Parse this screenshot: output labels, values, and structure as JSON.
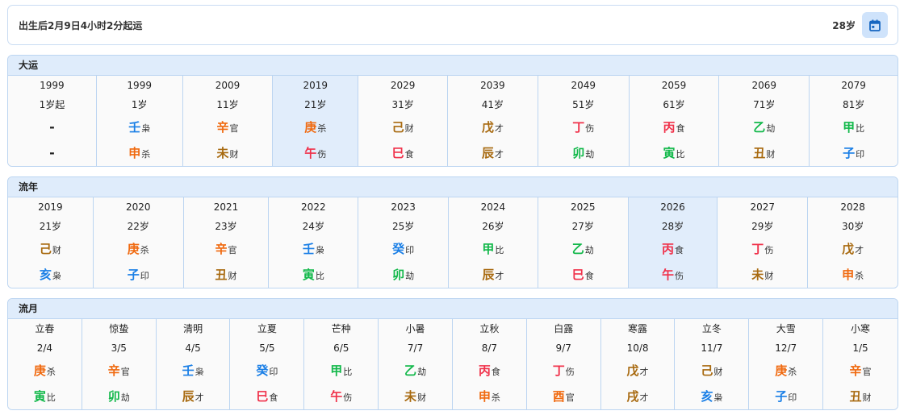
{
  "header": {
    "qiyun_text": "出生后2月9日4小时2分起运",
    "age": "28岁",
    "calendar_icon": "calendar-icon"
  },
  "dayun": {
    "title": "大运",
    "columns": [
      {
        "l1": "1999",
        "l2": "1岁起",
        "gan": "-",
        "gan_ss": "",
        "gan_el": "",
        "zhi": "-",
        "zhi_ss": "",
        "zhi_el": "",
        "cur": false
      },
      {
        "l1": "1999",
        "l2": "1岁",
        "gan": "壬",
        "gan_ss": "枭",
        "gan_el": "water",
        "zhi": "申",
        "zhi_ss": "杀",
        "zhi_el": "metal",
        "cur": false
      },
      {
        "l1": "2009",
        "l2": "11岁",
        "gan": "辛",
        "gan_ss": "官",
        "gan_el": "metal",
        "zhi": "未",
        "zhi_ss": "财",
        "zhi_el": "earth",
        "cur": false
      },
      {
        "l1": "2019",
        "l2": "21岁",
        "gan": "庚",
        "gan_ss": "杀",
        "gan_el": "metal",
        "zhi": "午",
        "zhi_ss": "伤",
        "zhi_el": "fire",
        "cur": true
      },
      {
        "l1": "2029",
        "l2": "31岁",
        "gan": "己",
        "gan_ss": "财",
        "gan_el": "earth",
        "zhi": "巳",
        "zhi_ss": "食",
        "zhi_el": "fire",
        "cur": false
      },
      {
        "l1": "2039",
        "l2": "41岁",
        "gan": "戊",
        "gan_ss": "才",
        "gan_el": "earth",
        "zhi": "辰",
        "zhi_ss": "才",
        "zhi_el": "earth",
        "cur": false
      },
      {
        "l1": "2049",
        "l2": "51岁",
        "gan": "丁",
        "gan_ss": "伤",
        "gan_el": "fire",
        "zhi": "卯",
        "zhi_ss": "劫",
        "zhi_el": "wood",
        "cur": false
      },
      {
        "l1": "2059",
        "l2": "61岁",
        "gan": "丙",
        "gan_ss": "食",
        "gan_el": "fire",
        "zhi": "寅",
        "zhi_ss": "比",
        "zhi_el": "wood",
        "cur": false
      },
      {
        "l1": "2069",
        "l2": "71岁",
        "gan": "乙",
        "gan_ss": "劫",
        "gan_el": "wood",
        "zhi": "丑",
        "zhi_ss": "财",
        "zhi_el": "earth",
        "cur": false
      },
      {
        "l1": "2079",
        "l2": "81岁",
        "gan": "甲",
        "gan_ss": "比",
        "gan_el": "wood",
        "zhi": "子",
        "zhi_ss": "印",
        "zhi_el": "water",
        "cur": false
      }
    ]
  },
  "liunian": {
    "title": "流年",
    "columns": [
      {
        "l1": "2019",
        "l2": "21岁",
        "gan": "己",
        "gan_ss": "财",
        "gan_el": "earth",
        "zhi": "亥",
        "zhi_ss": "枭",
        "zhi_el": "water",
        "cur": false
      },
      {
        "l1": "2020",
        "l2": "22岁",
        "gan": "庚",
        "gan_ss": "杀",
        "gan_el": "metal",
        "zhi": "子",
        "zhi_ss": "印",
        "zhi_el": "water",
        "cur": false
      },
      {
        "l1": "2021",
        "l2": "23岁",
        "gan": "辛",
        "gan_ss": "官",
        "gan_el": "metal",
        "zhi": "丑",
        "zhi_ss": "财",
        "zhi_el": "earth",
        "cur": false
      },
      {
        "l1": "2022",
        "l2": "24岁",
        "gan": "壬",
        "gan_ss": "枭",
        "gan_el": "water",
        "zhi": "寅",
        "zhi_ss": "比",
        "zhi_el": "wood",
        "cur": false
      },
      {
        "l1": "2023",
        "l2": "25岁",
        "gan": "癸",
        "gan_ss": "印",
        "gan_el": "water",
        "zhi": "卯",
        "zhi_ss": "劫",
        "zhi_el": "wood",
        "cur": false
      },
      {
        "l1": "2024",
        "l2": "26岁",
        "gan": "甲",
        "gan_ss": "比",
        "gan_el": "wood",
        "zhi": "辰",
        "zhi_ss": "才",
        "zhi_el": "earth",
        "cur": false
      },
      {
        "l1": "2025",
        "l2": "27岁",
        "gan": "乙",
        "gan_ss": "劫",
        "gan_el": "wood",
        "zhi": "巳",
        "zhi_ss": "食",
        "zhi_el": "fire",
        "cur": false
      },
      {
        "l1": "2026",
        "l2": "28岁",
        "gan": "丙",
        "gan_ss": "食",
        "gan_el": "fire",
        "zhi": "午",
        "zhi_ss": "伤",
        "zhi_el": "fire",
        "cur": true
      },
      {
        "l1": "2027",
        "l2": "29岁",
        "gan": "丁",
        "gan_ss": "伤",
        "gan_el": "fire",
        "zhi": "未",
        "zhi_ss": "财",
        "zhi_el": "earth",
        "cur": false
      },
      {
        "l1": "2028",
        "l2": "30岁",
        "gan": "戊",
        "gan_ss": "才",
        "gan_el": "earth",
        "zhi": "申",
        "zhi_ss": "杀",
        "zhi_el": "metal",
        "cur": false
      }
    ]
  },
  "liuyue": {
    "title": "流月",
    "columns": [
      {
        "l1": "立春",
        "l2": "2/4",
        "gan": "庚",
        "gan_ss": "杀",
        "gan_el": "metal",
        "zhi": "寅",
        "zhi_ss": "比",
        "zhi_el": "wood",
        "cur": false
      },
      {
        "l1": "惊蛰",
        "l2": "3/5",
        "gan": "辛",
        "gan_ss": "官",
        "gan_el": "metal",
        "zhi": "卯",
        "zhi_ss": "劫",
        "zhi_el": "wood",
        "cur": false
      },
      {
        "l1": "清明",
        "l2": "4/5",
        "gan": "壬",
        "gan_ss": "枭",
        "gan_el": "water",
        "zhi": "辰",
        "zhi_ss": "才",
        "zhi_el": "earth",
        "cur": false
      },
      {
        "l1": "立夏",
        "l2": "5/5",
        "gan": "癸",
        "gan_ss": "印",
        "gan_el": "water",
        "zhi": "巳",
        "zhi_ss": "食",
        "zhi_el": "fire",
        "cur": false
      },
      {
        "l1": "芒种",
        "l2": "6/5",
        "gan": "甲",
        "gan_ss": "比",
        "gan_el": "wood",
        "zhi": "午",
        "zhi_ss": "伤",
        "zhi_el": "fire",
        "cur": false
      },
      {
        "l1": "小暑",
        "l2": "7/7",
        "gan": "乙",
        "gan_ss": "劫",
        "gan_el": "wood",
        "zhi": "未",
        "zhi_ss": "财",
        "zhi_el": "earth",
        "cur": false
      },
      {
        "l1": "立秋",
        "l2": "8/7",
        "gan": "丙",
        "gan_ss": "食",
        "gan_el": "fire",
        "zhi": "申",
        "zhi_ss": "杀",
        "zhi_el": "metal",
        "cur": false
      },
      {
        "l1": "白露",
        "l2": "9/7",
        "gan": "丁",
        "gan_ss": "伤",
        "gan_el": "fire",
        "zhi": "酉",
        "zhi_ss": "官",
        "zhi_el": "metal",
        "cur": false
      },
      {
        "l1": "寒露",
        "l2": "10/8",
        "gan": "戊",
        "gan_ss": "才",
        "gan_el": "earth",
        "zhi": "戌",
        "zhi_ss": "才",
        "zhi_el": "earth",
        "cur": false
      },
      {
        "l1": "立冬",
        "l2": "11/7",
        "gan": "己",
        "gan_ss": "财",
        "gan_el": "earth",
        "zhi": "亥",
        "zhi_ss": "枭",
        "zhi_el": "water",
        "cur": false
      },
      {
        "l1": "大雪",
        "l2": "12/7",
        "gan": "庚",
        "gan_ss": "杀",
        "gan_el": "metal",
        "zhi": "子",
        "zhi_ss": "印",
        "zhi_el": "water",
        "cur": false
      },
      {
        "l1": "小寒",
        "l2": "1/5",
        "gan": "辛",
        "gan_ss": "官",
        "gan_el": "metal",
        "zhi": "丑",
        "zhi_ss": "财",
        "zhi_el": "earth",
        "cur": false
      }
    ]
  },
  "colors": {
    "wood": "#12b84a",
    "fire": "#f0314a",
    "earth": "#a86a10",
    "metal": "#f06a10",
    "water": "#1a7fe6",
    "header_bg": "#dfecfb",
    "current_bg": "#e1edfb",
    "border": "#bcd5f1"
  }
}
